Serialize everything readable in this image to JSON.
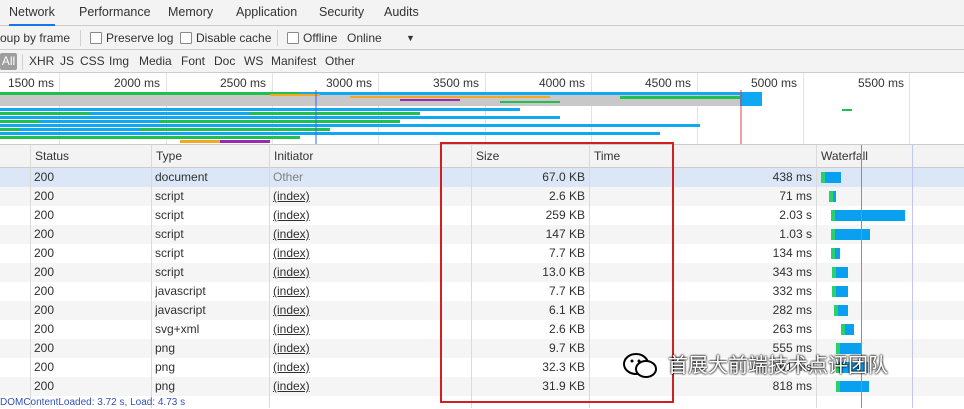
{
  "tabs": [
    "Network",
    "Performance",
    "Memory",
    "Application",
    "Security",
    "Audits"
  ],
  "toolbar": {
    "group_by_frame": "oup by frame",
    "preserve_log": "Preserve log",
    "disable_cache": "Disable cache",
    "offline": "Offline",
    "throttle": "Online"
  },
  "filters": [
    "All",
    "XHR",
    "JS",
    "CSS",
    "Img",
    "Media",
    "Font",
    "Doc",
    "WS",
    "Manifest",
    "Other"
  ],
  "overview_ticks": [
    "1500 ms",
    "2000 ms",
    "2500 ms",
    "3000 ms",
    "3500 ms",
    "4000 ms",
    "4500 ms",
    "5000 ms",
    "5500 ms"
  ],
  "columns": {
    "status": "Status",
    "type": "Type",
    "initiator": "Initiator",
    "size": "Size",
    "time": "Time",
    "waterfall": "Waterfall"
  },
  "rows": [
    {
      "status": "200",
      "type": "document",
      "initiator": "Other",
      "size": "67.0 KB",
      "time": "438 ms",
      "wf_start": 0.02,
      "wf_len": 0.19
    },
    {
      "status": "200",
      "type": "script",
      "initiator": "(index)",
      "size": "2.6 KB",
      "time": "71 ms",
      "wf_start": 0.08,
      "wf_len": 0.03
    },
    {
      "status": "200",
      "type": "script",
      "initiator": "(index)",
      "size": "259 KB",
      "time": "2.03 s",
      "wf_start": 0.09,
      "wf_len": 0.82
    },
    {
      "status": "200",
      "type": "script",
      "initiator": "(index)",
      "size": "147 KB",
      "time": "1.03 s",
      "wf_start": 0.09,
      "wf_len": 0.41
    },
    {
      "status": "200",
      "type": "script",
      "initiator": "(index)",
      "size": "7.7 KB",
      "time": "134 ms",
      "wf_start": 0.09,
      "wf_len": 0.06
    },
    {
      "status": "200",
      "type": "script",
      "initiator": "(index)",
      "size": "13.0 KB",
      "time": "343 ms",
      "wf_start": 0.1,
      "wf_len": 0.14
    },
    {
      "status": "200",
      "type": "javascript",
      "initiator": "(index)",
      "size": "7.7 KB",
      "time": "332 ms",
      "wf_start": 0.1,
      "wf_len": 0.14
    },
    {
      "status": "200",
      "type": "javascript",
      "initiator": "(index)",
      "size": "6.1 KB",
      "time": "282 ms",
      "wf_start": 0.11,
      "wf_len": 0.12
    },
    {
      "status": "200",
      "type": "svg+xml",
      "initiator": "(index)",
      "size": "2.6 KB",
      "time": "263 ms",
      "wf_start": 0.16,
      "wf_len": 0.11
    },
    {
      "status": "200",
      "type": "png",
      "initiator": "(index)",
      "size": "9.7 KB",
      "time": "555 ms",
      "wf_start": 0.13,
      "wf_len": 0.24
    },
    {
      "status": "200",
      "type": "png",
      "initiator": "(index)",
      "size": "32.3 KB",
      "time": "761 ms",
      "wf_start": 0.13,
      "wf_len": 0.32
    },
    {
      "status": "200",
      "type": "png",
      "initiator": "(index)",
      "size": "31.9 KB",
      "time": "818 ms",
      "wf_start": 0.13,
      "wf_len": 0.34
    }
  ],
  "watermark": "首展大前端技术点评团队",
  "status_bar": "DOMContentLoaded: 3.72 s, Load: 4.73 s",
  "colors": {
    "accent": "#1a73e8",
    "highlight": "#d02020",
    "wf_blue": "#0aa0f0",
    "wf_green": "#2ad06a"
  }
}
